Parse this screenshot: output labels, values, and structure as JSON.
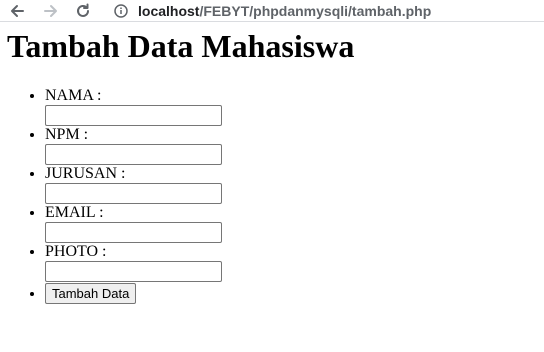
{
  "browser": {
    "url_host": "localhost",
    "url_path": "/FEBYT/phpdanmysqli/tambah.php"
  },
  "page": {
    "title": "Tambah Data Mahasiswa"
  },
  "form": {
    "fields": [
      {
        "label": "NAMA :",
        "value": ""
      },
      {
        "label": "NPM :",
        "value": ""
      },
      {
        "label": "JURUSAN :",
        "value": ""
      },
      {
        "label": "EMAIL :",
        "value": ""
      },
      {
        "label": "PHOTO :",
        "value": ""
      }
    ],
    "submit_label": "Tambah Data"
  }
}
